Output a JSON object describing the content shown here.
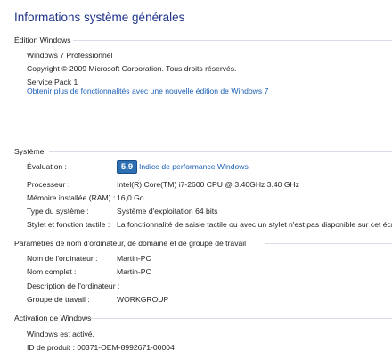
{
  "page": {
    "title": "Informations système générales"
  },
  "edition": {
    "heading": "Édition Windows",
    "name": "Windows 7 Professionnel",
    "copyright": "Copyright © 2009 Microsoft Corporation. Tous droits réservés.",
    "service_pack": "Service Pack 1",
    "upgrade_link": "Obtenir plus de fonctionnalités avec une nouvelle édition de Windows 7"
  },
  "system": {
    "heading": "Système",
    "rating": {
      "label": "Évaluation :",
      "score": "5,9",
      "link": "Indice de performance Windows"
    },
    "rows": [
      {
        "label": "Processeur :",
        "value": "Intel(R) Core(TM) i7-2600 CPU @ 3.40GHz   3.40 GHz"
      },
      {
        "label": "Mémoire installée (RAM) :",
        "value": "16,0 Go"
      },
      {
        "label": "Type du système :",
        "value": "Système d'exploitation 64 bits"
      },
      {
        "label": "Stylet et fonction tactile :",
        "value": "La fonctionnalité de saisie tactile ou avec un stylet n'est pas disponible sur cet écran"
      }
    ]
  },
  "computer": {
    "heading": "Paramètres de nom d'ordinateur, de domaine et de groupe de travail",
    "rows": [
      {
        "label": "Nom de l'ordinateur :",
        "value": "Martin-PC"
      },
      {
        "label": "Nom complet :",
        "value": "Martin-PC"
      },
      {
        "label": "Description de l'ordinateur :",
        "value": ""
      },
      {
        "label": "Groupe de travail :",
        "value": "WORKGROUP"
      }
    ]
  },
  "activation": {
    "heading": "Activation de Windows",
    "status": "Windows est activé.",
    "product_id": "ID de produit : 00371-OEM-8992671-00004"
  }
}
